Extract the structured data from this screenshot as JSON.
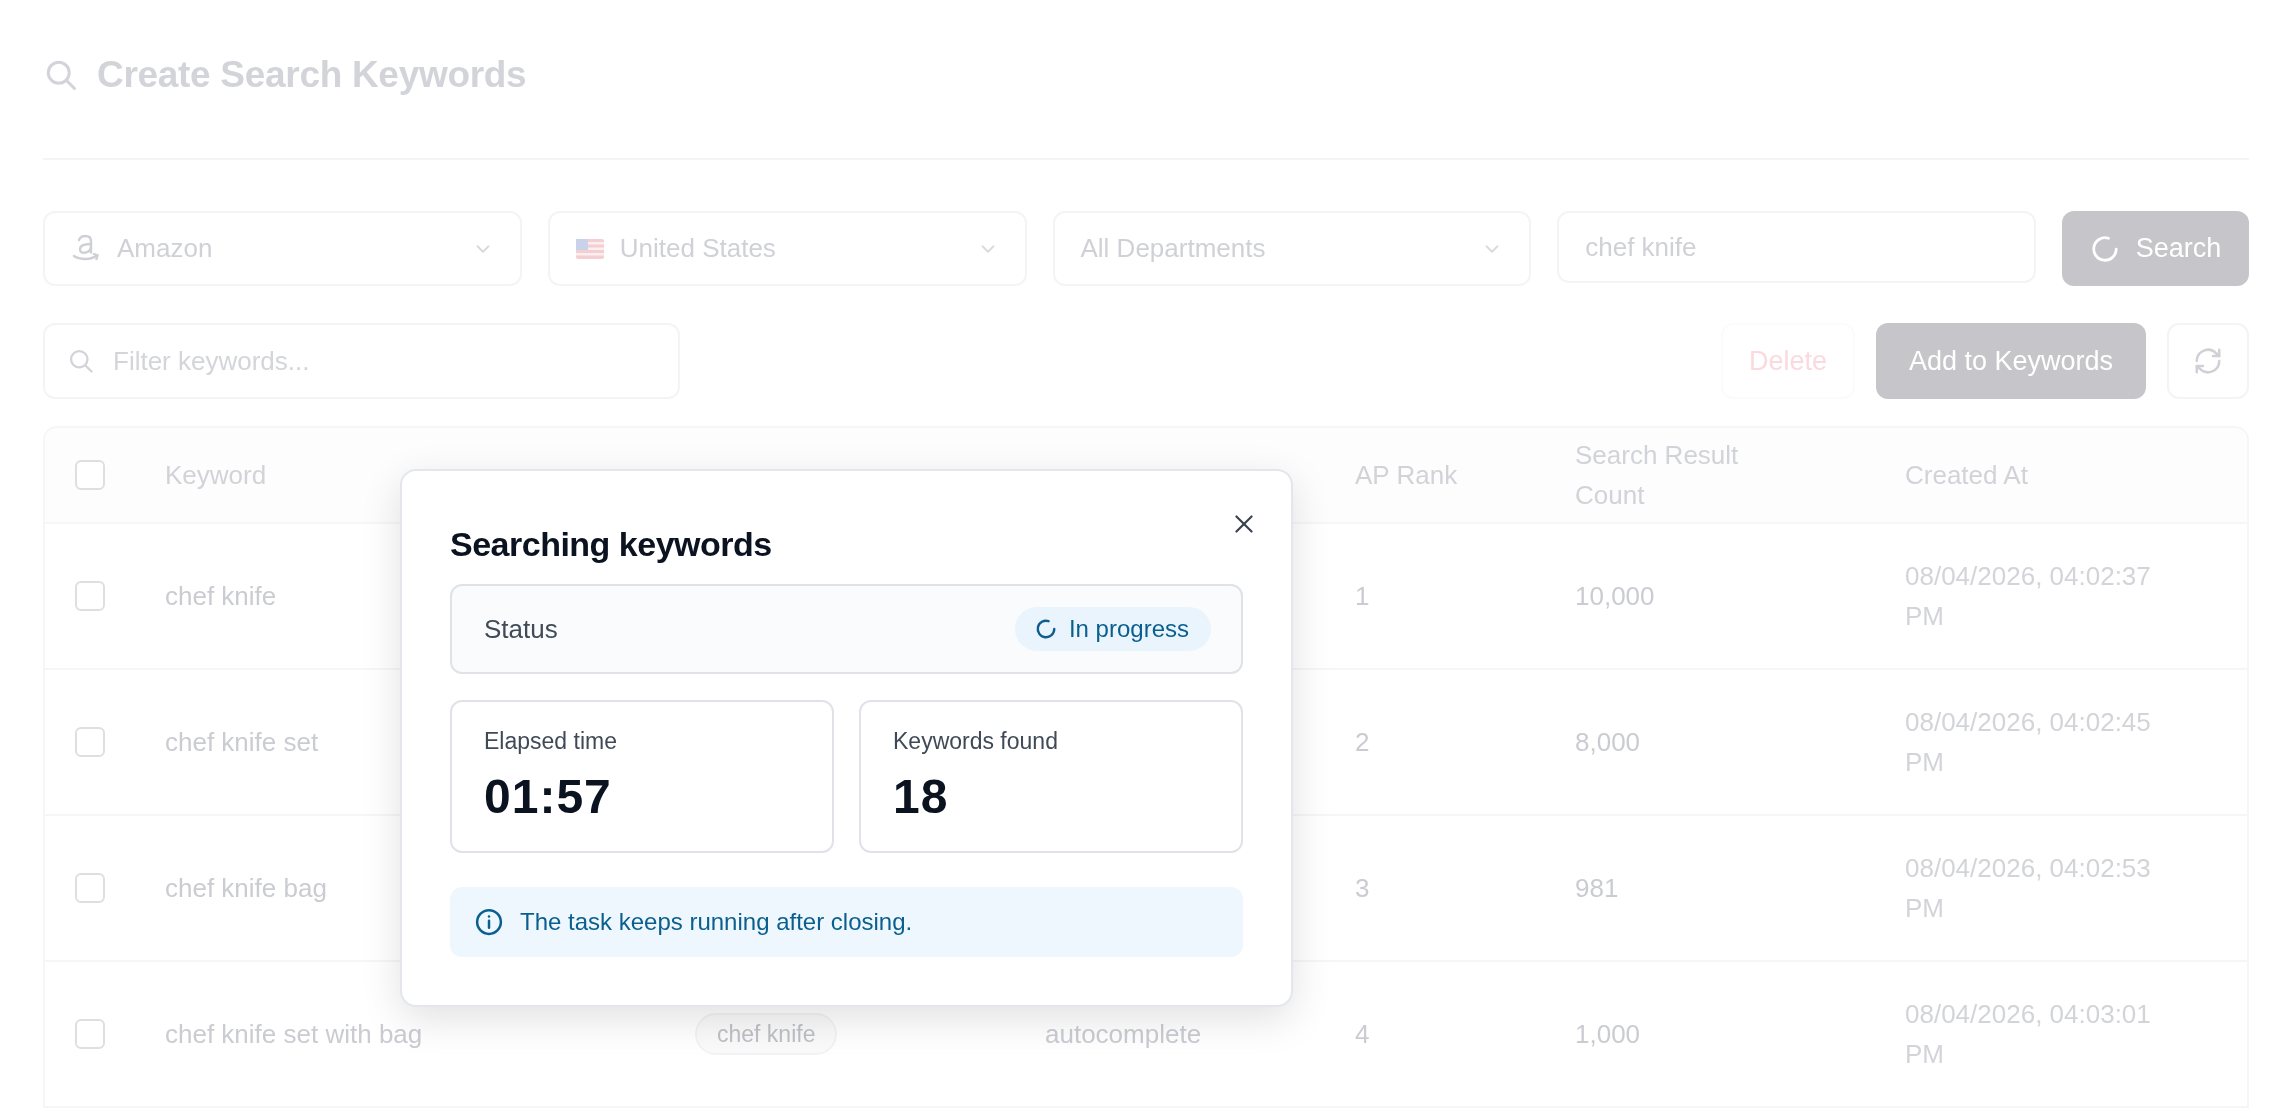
{
  "header": {
    "title": "Create Search Keywords"
  },
  "filters": {
    "marketplace": "Amazon",
    "country": "United States",
    "department": "All Departments",
    "query": "chef knife",
    "search_button": {
      "label": "Search",
      "loading": true
    }
  },
  "toolbar": {
    "filter_placeholder": "Filter keywords...",
    "delete_button": {
      "label": "Delete",
      "disabled": true
    },
    "add_button": {
      "label": "Add to Keywords",
      "disabled": true
    }
  },
  "table": {
    "header_checked": false,
    "columns": {
      "keyword": "Keyword",
      "ap_rank": "AP Rank",
      "search_result_count": "Search Result Count",
      "created_at": "Created At"
    },
    "rows": [
      {
        "checked": false,
        "keyword": "chef knife",
        "ap_rank": "1",
        "search_result_count": "10,000",
        "created_at": "08/04/2026, 04:02:37 PM"
      },
      {
        "checked": false,
        "keyword": "chef knife set",
        "ap_rank": "2",
        "search_result_count": "8,000",
        "created_at": "08/04/2026, 04:02:45 PM"
      },
      {
        "checked": false,
        "keyword": "chef knife bag",
        "ap_rank": "3",
        "search_result_count": "981",
        "created_at": "08/04/2026, 04:02:53 PM"
      },
      {
        "checked": false,
        "keyword": "chef knife set with bag",
        "column_3": "chef knife",
        "column_4": "autocomplete",
        "ap_rank": "4",
        "search_result_count": "1,000",
        "created_at": "08/04/2026, 04:03:01 PM"
      }
    ]
  },
  "modal": {
    "title": "Searching keywords",
    "status_label": "Status",
    "status": {
      "kind": "running",
      "label": "In progress"
    },
    "stats": [
      {
        "label": "Elapsed time",
        "value": "01:57"
      },
      {
        "label": "Keywords found",
        "value": "18"
      }
    ],
    "note": "The task keeps running after closing."
  }
}
